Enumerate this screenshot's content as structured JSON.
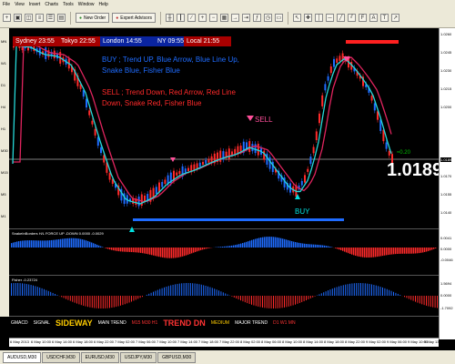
{
  "menu": [
    "File",
    "View",
    "Insert",
    "Charts",
    "Tools",
    "Window",
    "Help"
  ],
  "toolbar": {
    "new_order": "New Order",
    "expert_advisors": "Expert Advisors"
  },
  "clocks": {
    "sydney": "Sydney 23:55",
    "tokyo": "Tokyo 22:55",
    "london": "London 14:55",
    "ny": "NY  09:55",
    "local": "Local  21:55"
  },
  "notes": {
    "buy": "BUY ; Trend UP, Blue Arrow, Blue Line Up, Snake Blue, Fisher Blue",
    "sell": "SELL ; Trend Down, Red Arrow, Red Line Down, Snake Red, Fisher Blue"
  },
  "signals": {
    "sell": "SELL",
    "buy": "BUY"
  },
  "price": {
    "current": "1.0189",
    "small": "≈0.20"
  },
  "left_axis": [
    "MN",
    "W1",
    "D1",
    "H4",
    "H1",
    "M30",
    "M15",
    "M5",
    "M1"
  ],
  "right_axis": {
    "main": [
      "1.0260",
      "1.0245",
      "1.0230",
      "1.0215",
      "1.0200",
      "1.0189",
      "1.0170",
      "1.0155",
      "1.0140"
    ],
    "snake": [
      "0.0041",
      "0.0000",
      "-0.0046"
    ],
    "fisher": [
      "1.5694",
      "0.0000",
      "-1.7092"
    ]
  },
  "indicators": {
    "snake_title": "SnakeInBorders H/L FORCE UP -DOWN  0.0000 -0.0029",
    "fisher_title": "Fisher -0.23724"
  },
  "bottom_panel": {
    "label": "GMACD",
    "signal": "SIGNAL",
    "sideway": "SIDEWAY",
    "main_trend": "MAIN TREND",
    "main_trend_tf": "M15 M30 H1",
    "trend_dn": "TREND DN",
    "medium": "MEDIUM",
    "major_trend": "MAJOR TREND",
    "major_trend_tf": "D1 W1 MN"
  },
  "time_axis": [
    "6 May 2013",
    "6 May 10:00",
    "6 May 14:00",
    "6 May 18:00",
    "6 May 22:00",
    "7 May 02:00",
    "7 May 06:00",
    "7 May 10:00",
    "7 May 14:00",
    "7 May 18:00",
    "7 May 22:00",
    "8 May 02:00",
    "8 May 06:00",
    "8 May 10:00",
    "8 May 14:00",
    "8 May 18:00",
    "8 May 22:00",
    "9 May 02:00",
    "9 May 06:00",
    "9 May 10:00",
    "9 May 13:00"
  ],
  "tabs": [
    "AUDUSD,M30",
    "USDCHF,M30",
    "EURUSD,M30",
    "USDJPY,M30",
    "GBPUSD,M30"
  ],
  "colors": {
    "bull": "#1f6cff",
    "bear": "#ff2a2a",
    "snake_line": "#e0245e",
    "fast_line": "#25d9d9",
    "price_line": "#ffffff"
  }
}
